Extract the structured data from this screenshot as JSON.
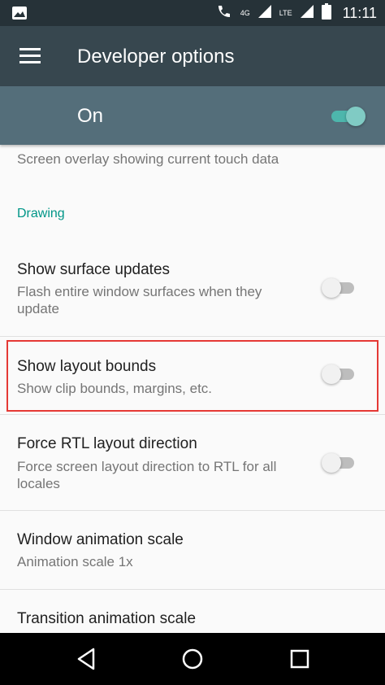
{
  "status_bar": {
    "time": "11:11",
    "network_badge": "4G",
    "lte_badge": "LTE",
    "icons": [
      "image-icon",
      "wifi-call-icon",
      "signal-icon",
      "signal-icon",
      "battery-icon"
    ]
  },
  "toolbar": {
    "title": "Developer options",
    "menu_icon": "hamburger-menu-icon"
  },
  "master_switch": {
    "label": "On",
    "checked": true,
    "accent_color": "#80cbc4"
  },
  "settings": {
    "partial_item": {
      "summary": "Screen overlay showing current touch data",
      "checked": false
    },
    "section_header": "Drawing",
    "items": [
      {
        "title": "Show surface updates",
        "summary": "Flash entire window surfaces when they update",
        "has_switch": true,
        "checked": false
      },
      {
        "title": "Show layout bounds",
        "summary": "Show clip bounds, margins, etc.",
        "has_switch": true,
        "checked": false,
        "highlighted": true
      },
      {
        "title": "Force RTL layout direction",
        "summary": "Force screen layout direction to RTL for all locales",
        "has_switch": true,
        "checked": false
      },
      {
        "title": "Window animation scale",
        "summary": "Animation scale 1x",
        "has_switch": false
      },
      {
        "title": "Transition animation scale",
        "summary": "",
        "has_switch": false
      }
    ]
  },
  "nav_bar": {
    "buttons": [
      "back-icon",
      "home-icon",
      "recents-icon"
    ]
  },
  "colors": {
    "status_bar": "#263238",
    "toolbar": "#37474f",
    "master_bar": "#546e7a",
    "section_header": "#009688",
    "highlight": "#e53935"
  }
}
